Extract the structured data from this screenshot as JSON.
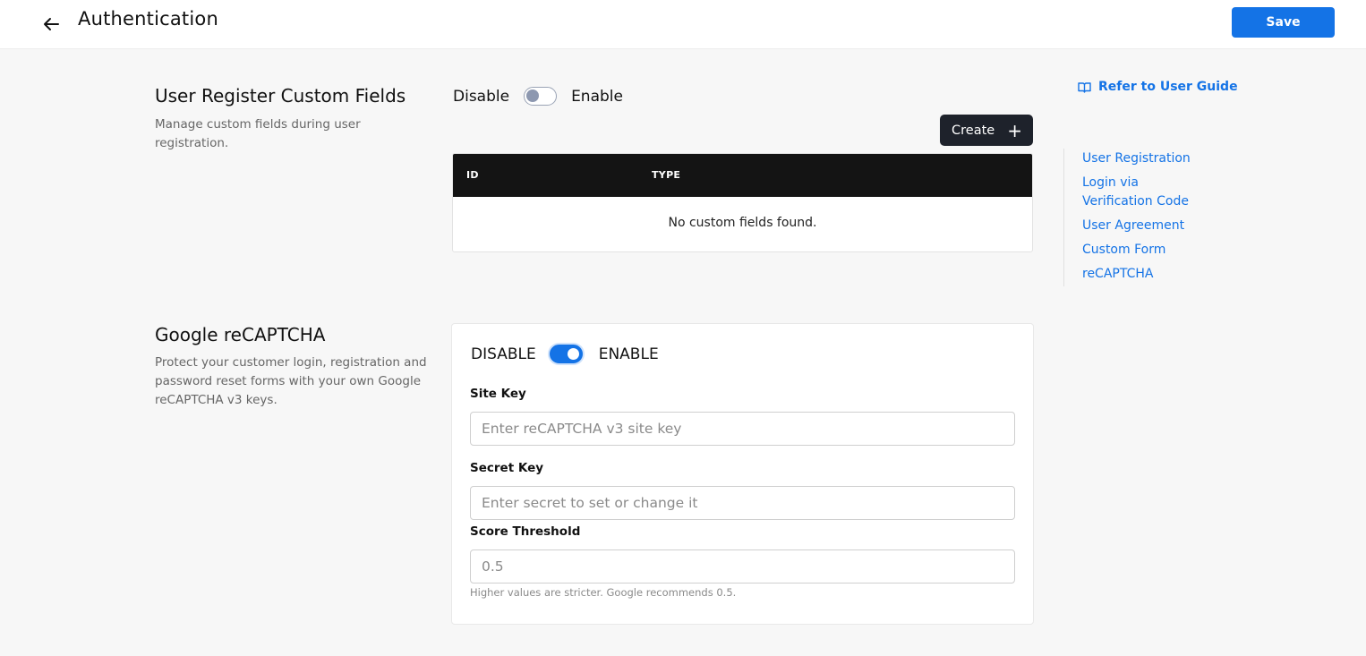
{
  "header": {
    "title": "Authentication",
    "save_label": "Save"
  },
  "custom_fields": {
    "title": "User Register Custom Fields",
    "description": "Manage custom fields during user registration.",
    "toggle": {
      "off_label": "Disable",
      "on_label": "Enable",
      "enabled": false
    },
    "create_label": "Create",
    "table": {
      "columns": [
        "ID",
        "TYPE"
      ],
      "rows": [],
      "empty_message": "No custom fields found."
    }
  },
  "recaptcha": {
    "title": "Google reCAPTCHA",
    "description": "Protect your customer login, registration and password reset forms with your own Google reCAPTCHA v3 keys.",
    "toggle": {
      "off_label": "DISABLE",
      "on_label": "ENABLE",
      "enabled": true
    },
    "site_key": {
      "label": "Site Key",
      "placeholder": "Enter reCAPTCHA v3 site key",
      "value": ""
    },
    "secret_key": {
      "label": "Secret Key",
      "placeholder": "Enter secret to set or change it",
      "value": ""
    },
    "score_threshold": {
      "label": "Score Threshold",
      "placeholder": "0.5",
      "value": "",
      "help": "Higher values are stricter. Google recommends 0.5."
    }
  },
  "sidebar": {
    "guide_label": "Refer to User Guide",
    "toc": [
      "User Registration",
      "Login via Verification Code",
      "User Agreement",
      "Custom Form",
      "reCAPTCHA"
    ]
  },
  "colors": {
    "accent": "#1473e6",
    "dark_button": "#1e222b",
    "table_header": "#141414",
    "background": "#f7f7f7"
  }
}
